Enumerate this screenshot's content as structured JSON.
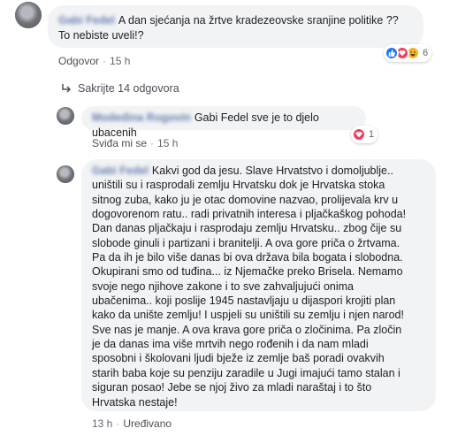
{
  "comment1": {
    "author": "Gabi Fedel",
    "text_line1": "A dan sjećanja na žrtve kradezeovske sranjine politike ??",
    "text_line2": "To nebiste uveli!?",
    "reply_action": "Odgovor",
    "time": "15 h",
    "reactions": {
      "icons": [
        "like-icon",
        "love-icon",
        "haha-icon"
      ],
      "count": "6"
    }
  },
  "hide_replies": {
    "label": "Sakrijte 14 odgovora"
  },
  "reply1": {
    "author": "Modedina Rogovin",
    "text": "Gabi Fedel sve je to djelo ubacenih",
    "like_action": "Sviđa mi se",
    "time": "15 h",
    "reactions": {
      "icons": [
        "love-icon"
      ],
      "count": "1"
    }
  },
  "reply2": {
    "author": "Gabi Fedel",
    "lines": [
      "Kakvi god da jesu. Slave Hrvatstvo i domoljublje..",
      "uništili su i rasprodali zemlju Hrvatsku dok je Hrvatska stoka",
      "sitnog zuba, kako ju je otac domovine nazvao, prolijevala krv u",
      "dogovorenom ratu.. radi privatnih interesa i pljačkaškog pohoda!",
      "Dan danas pljačkaju i rasprodaju zemlju Hrvatsku.. zbog čije su",
      "slobode ginuli i partizani i branitelji. A ova gore priča o žrtvama.",
      "Pa da ih je bilo više danas bi ova država bila bogata i slobodna.",
      "Okupirani smo od tuđina... iz Njemačke preko Brisela. Nemamo",
      "svoje nego njihove zakone i to sve zahvaljujući onima",
      "ubačenima.. koji poslije 1945 nastavljaju u dijaspori krojiti plan",
      "kako da unište zemlju! I uspjeli su uništili su zemlju i njen narod!",
      "Sve nas je manje. A ova krava gore priča o zločinima. Pa zločin",
      "je da danas ima više mrtvih nego rođenih i da nam mladi",
      "sposobni i školovani ljudi bježe iz zemlje baš poradi ovakvih",
      "starih baba koje su penziju zaradile u Jugi imajući tamo stalan i",
      "siguran posao! Jebe se njoj živo za mladi naraštaj i to što",
      "Hrvatska nestaje!"
    ],
    "time": "13 h",
    "edited": "Uređivano"
  }
}
